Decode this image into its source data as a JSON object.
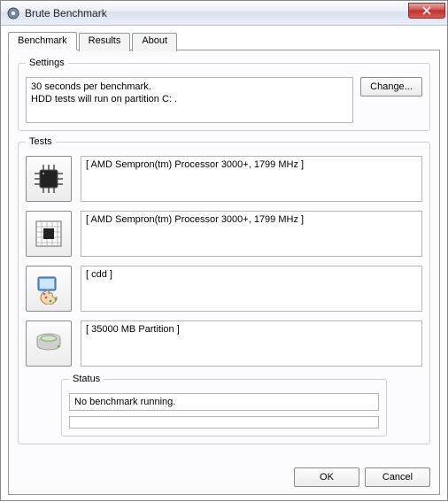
{
  "window": {
    "title": "Brute Benchmark"
  },
  "tabs": [
    {
      "label": "Benchmark",
      "active": true
    },
    {
      "label": "Results",
      "active": false
    },
    {
      "label": "About",
      "active": false
    }
  ],
  "settings": {
    "legend": "Settings",
    "text": "30 seconds per benchmark.\nHDD tests will run on partition C: .",
    "change_label": "Change..."
  },
  "tests": {
    "legend": "Tests",
    "items": [
      {
        "icon": "cpu-chip-icon",
        "label": "[ AMD Sempron(tm) Processor 3000+, 1799 MHz ]"
      },
      {
        "icon": "cpu-grid-icon",
        "label": "[ AMD Sempron(tm) Processor 3000+, 1799 MHz ]"
      },
      {
        "icon": "display-palette-icon",
        "label": "[ cdd ]"
      },
      {
        "icon": "hdd-icon",
        "label": "[ 35000 MB Partition ]"
      }
    ]
  },
  "status": {
    "legend": "Status",
    "text": "No benchmark running."
  },
  "buttons": {
    "ok": "OK",
    "cancel": "Cancel"
  }
}
